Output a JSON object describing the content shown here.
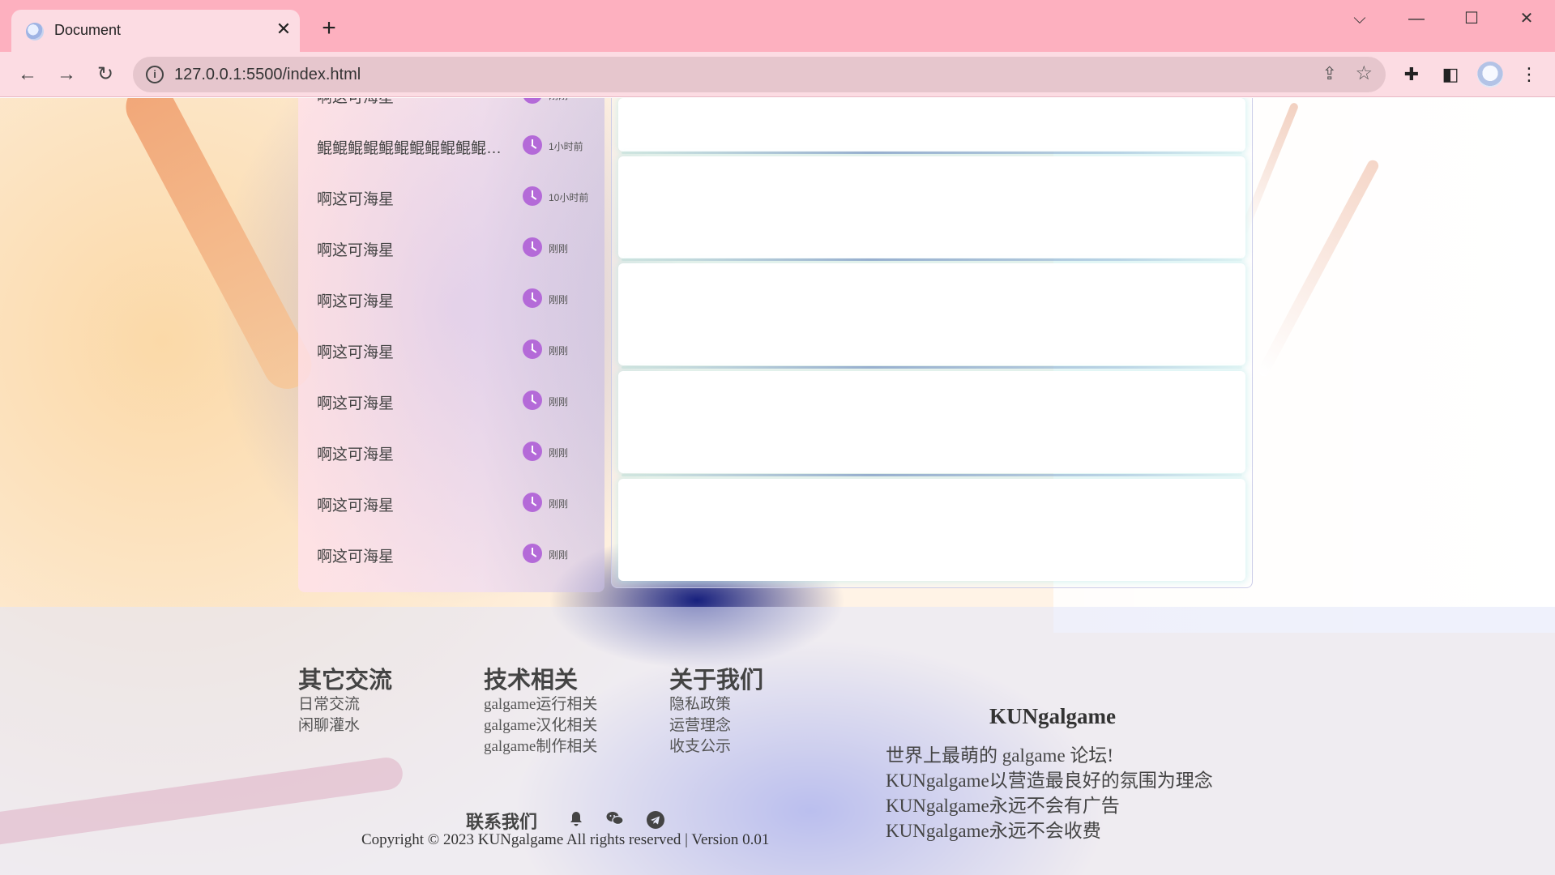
{
  "browser": {
    "tab_title": "Document",
    "url": "127.0.0.1:5500/index.html"
  },
  "topics": [
    {
      "title": "啊这可海星",
      "time": "刚刚"
    },
    {
      "title": "鲲鲲鲲鲲鲲鲲鲲鲲鲲鲲鲲鲲鲲鲲鲲鲲鲲鲲鲲鲲",
      "time": "1小时前"
    },
    {
      "title": "啊这可海星",
      "time": "10小时前"
    },
    {
      "title": "啊这可海星",
      "time": "刚刚"
    },
    {
      "title": "啊这可海星",
      "time": "刚刚"
    },
    {
      "title": "啊这可海星",
      "time": "刚刚"
    },
    {
      "title": "啊这可海星",
      "time": "刚刚"
    },
    {
      "title": "啊这可海星",
      "time": "刚刚"
    },
    {
      "title": "啊这可海星",
      "time": "刚刚"
    },
    {
      "title": "啊这可海星",
      "time": "刚刚"
    }
  ],
  "footer": {
    "columns": [
      {
        "heading": "其它交流",
        "links": [
          "日常交流",
          "闲聊灌水"
        ]
      },
      {
        "heading": "技术相关",
        "links": [
          "galgame运行相关",
          "galgame汉化相关",
          "galgame制作相关"
        ]
      },
      {
        "heading": "关于我们",
        "links": [
          "隐私政策",
          "运营理念",
          "收支公示"
        ]
      }
    ],
    "brand": "KUNgalgame",
    "slogans": [
      "世界上最萌的 galgame 论坛!",
      "KUNgalgame以营造最良好的氛围为理念",
      "KUNgalgame永远不会有广告",
      "KUNgalgame永远不会收费"
    ],
    "contact_label": "联系我们",
    "copyright": "Copyright © 2023 KUNgalgame All rights reserved | Version 0.01"
  },
  "icons": {
    "contact": [
      "bell-icon",
      "wechat-icon",
      "telegram-icon"
    ]
  },
  "colors": {
    "titlebar": "#fdb0bf",
    "toolbar": "#fcdce3",
    "clock_icon": "#b46ad8"
  }
}
